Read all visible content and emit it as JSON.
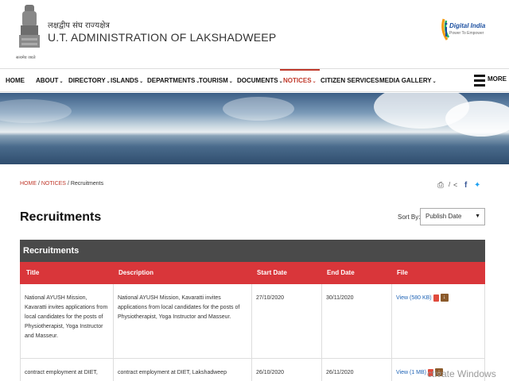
{
  "header": {
    "hindi_title": "लक्षद्वीप संघ राज्यक्षेत्र",
    "title": "U.T. ADMINISTRATION OF LAKSHADWEEP",
    "emblem_motto": "सत्यमेव जयते",
    "digital_india": "Digital India",
    "digital_india_tagline": "Power To Empower"
  },
  "nav": {
    "items": [
      {
        "label": "HOME",
        "caret": false,
        "active": false
      },
      {
        "label": "ABOUT",
        "caret": true,
        "active": false
      },
      {
        "label": "DIRECTORY",
        "caret": true,
        "active": false
      },
      {
        "label": "ISLANDS",
        "caret": true,
        "active": false
      },
      {
        "label": "DEPARTMENTS",
        "caret": true,
        "active": false
      },
      {
        "label": "TOURISM",
        "caret": true,
        "active": false
      },
      {
        "label": "DOCUMENTS",
        "caret": true,
        "active": false
      },
      {
        "label": "NOTICES",
        "caret": true,
        "active": true
      },
      {
        "label": "CITIZEN SERVICES",
        "caret": false,
        "active": false
      },
      {
        "label": "MEDIA GALLERY",
        "caret": true,
        "active": false
      }
    ],
    "more_label": "MORE"
  },
  "breadcrumb": {
    "home": "HOME",
    "notices": "NOTICES",
    "current": "Recruitments",
    "separator": "/"
  },
  "page": {
    "title": "Recruitments",
    "sort_label": "Sort By:",
    "sort_value": "Publish Date"
  },
  "table": {
    "caption": "Recruitments",
    "headers": [
      "Title",
      "Description",
      "Start Date",
      "End Date",
      "File"
    ],
    "rows": [
      {
        "title": "National AYUSH Mission, Kavaratti invites applications from local candidates for the posts of Physiotherapist, Yoga Instructor and Masseur.",
        "description": "National AYUSH Mission, Kavaratti invites applications from local candidates for the posts of Physiotherapist, Yoga Instructor and Masseur.",
        "start": "27/10/2020",
        "end": "30/11/2020",
        "file": "View (580 KB)"
      },
      {
        "title": "contract employment at DIET,",
        "description": "contract employment at DIET, Lakshadweep",
        "start": "26/10/2020",
        "end": "26/11/2020",
        "file": "View (1 MB)"
      }
    ]
  },
  "watermark": "ctivate Windows",
  "colors": {
    "accent_red": "#d9363a",
    "caption_bg": "#4a4a4a",
    "link_blue": "#1f63b5"
  }
}
